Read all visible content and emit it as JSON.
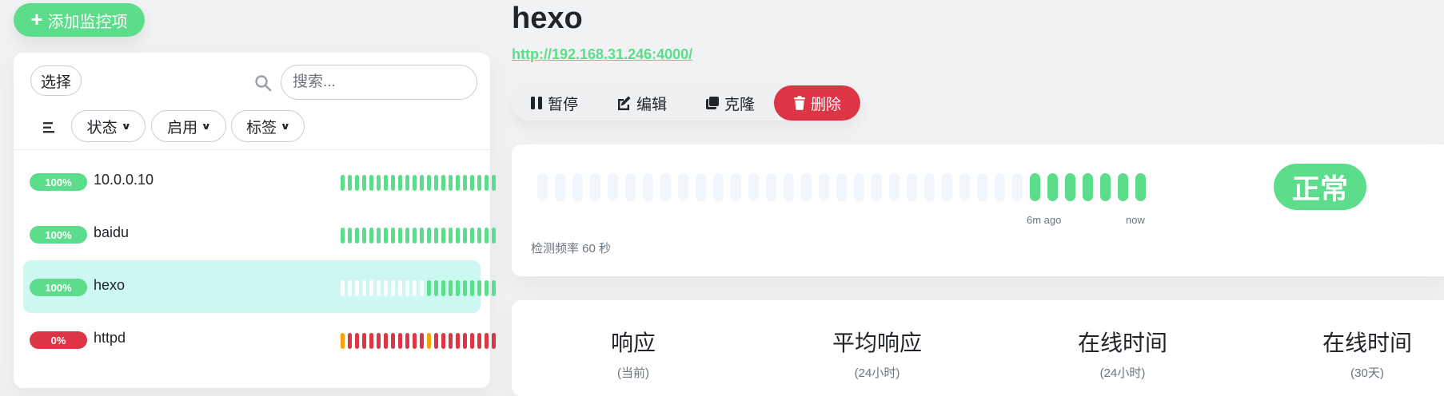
{
  "sidebar": {
    "add_button_label": "添加监控项",
    "select_label": "选择",
    "search_placeholder": "搜索...",
    "filters": [
      {
        "label": "状态"
      },
      {
        "label": "启用"
      },
      {
        "label": "标签"
      }
    ],
    "monitors": [
      {
        "uptime": "100%",
        "name": "10.0.0.10",
        "status": "up",
        "beats": [
          "up",
          "up",
          "up",
          "up",
          "up",
          "up",
          "up",
          "up",
          "up",
          "up",
          "up",
          "up",
          "up",
          "up",
          "up",
          "up",
          "up",
          "up",
          "up",
          "up",
          "up",
          "up"
        ]
      },
      {
        "uptime": "100%",
        "name": "baidu",
        "status": "up",
        "beats": [
          "up",
          "up",
          "up",
          "up",
          "up",
          "up",
          "up",
          "up",
          "up",
          "up",
          "up",
          "up",
          "up",
          "up",
          "up",
          "up",
          "up",
          "up",
          "up",
          "up",
          "up",
          "up"
        ]
      },
      {
        "uptime": "100%",
        "name": "hexo",
        "status": "up",
        "active": true,
        "beats": [
          "empty",
          "empty",
          "empty",
          "empty",
          "empty",
          "empty",
          "empty",
          "empty",
          "empty",
          "empty",
          "empty",
          "empty",
          "up",
          "up",
          "up",
          "up",
          "up",
          "up",
          "up",
          "up",
          "up",
          "up"
        ]
      },
      {
        "uptime": "0%",
        "name": "httpd",
        "status": "down",
        "beats": [
          "pending",
          "down",
          "down",
          "down",
          "down",
          "down",
          "down",
          "down",
          "down",
          "down",
          "down",
          "down",
          "pending",
          "down",
          "down",
          "down",
          "down",
          "down",
          "down",
          "down",
          "down",
          "down"
        ]
      }
    ]
  },
  "detail": {
    "title": "hexo",
    "url": "http://192.168.31.246:4000/",
    "actions": [
      {
        "label": "暂停"
      },
      {
        "label": "编辑"
      },
      {
        "label": "克隆"
      },
      {
        "label": "删除"
      }
    ],
    "heartbeat": {
      "beats": [
        "empty",
        "empty",
        "empty",
        "empty",
        "empty",
        "empty",
        "empty",
        "empty",
        "empty",
        "empty",
        "empty",
        "empty",
        "empty",
        "empty",
        "empty",
        "empty",
        "empty",
        "empty",
        "empty",
        "empty",
        "empty",
        "empty",
        "empty",
        "empty",
        "empty",
        "empty",
        "empty",
        "empty",
        "up",
        "up",
        "up",
        "up",
        "up",
        "up",
        "up"
      ],
      "ago_label": "6m ago",
      "now_label": "now",
      "interval_label": "检测频率 60 秒",
      "status_label": "正常"
    },
    "stats": [
      {
        "label": "响应",
        "sub": "(当前)"
      },
      {
        "label": "平均响应",
        "sub": "(24小时)"
      },
      {
        "label": "在线时间",
        "sub": "(24小时)"
      },
      {
        "label": "在线时间",
        "sub": "(30天)"
      }
    ]
  },
  "colors": {
    "up": "#5cdd8b",
    "down": "#dc3545",
    "pending": "#f8a306",
    "empty": "#f0f6fc",
    "mini_empty": "#ffffff",
    "active_bg": "#cdf8f1"
  },
  "icons": {
    "add": "plus-icon",
    "search": "search-icon",
    "filter_menu": "filter-lines-icon",
    "chevron": "chevron-down-icon",
    "pause": "pause-icon",
    "edit": "edit-icon",
    "clone": "clone-icon",
    "delete": "trash-icon"
  }
}
